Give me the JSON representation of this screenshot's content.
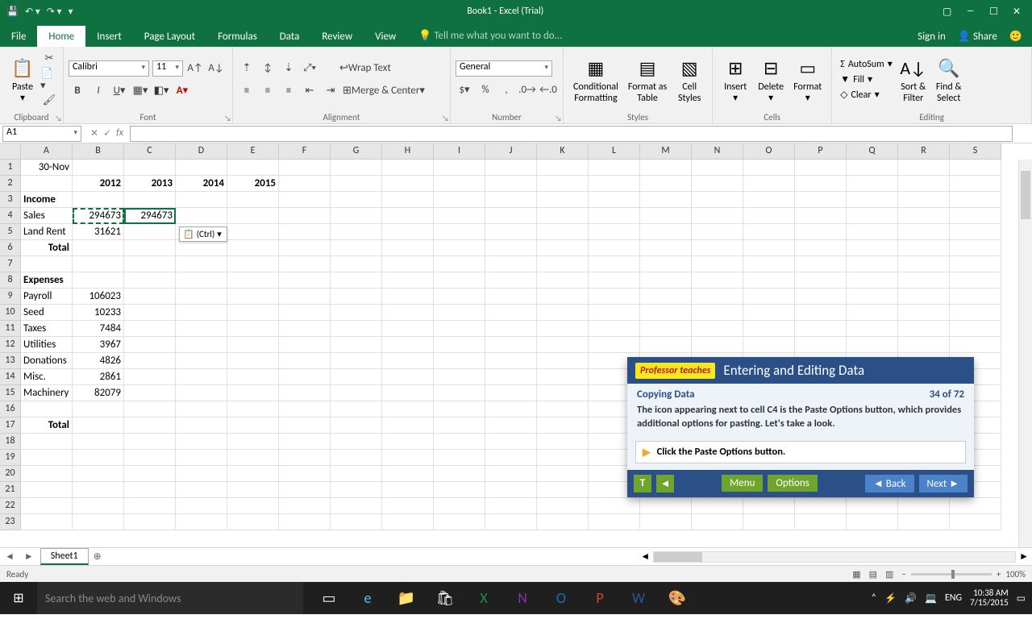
{
  "titlebar": {
    "title": "Book1 - Excel (Trial)"
  },
  "tabs": {
    "file": "File",
    "home": "Home",
    "insert": "Insert",
    "pagelayout": "Page Layout",
    "formulas": "Formulas",
    "data": "Data",
    "review": "Review",
    "view": "View",
    "tell": "Tell me what you want to do...",
    "signin": "Sign in",
    "share": "Share"
  },
  "ribbon": {
    "clipboard": {
      "label": "Clipboard",
      "paste": "Paste"
    },
    "font": {
      "label": "Font",
      "name": "Calibri",
      "size": "11"
    },
    "alignment": {
      "label": "Alignment",
      "wrap": "Wrap Text",
      "merge": "Merge & Center"
    },
    "number": {
      "label": "Number",
      "format": "General"
    },
    "styles": {
      "label": "Styles",
      "cond": "Conditional\nFormatting",
      "fat": "Format as\nTable",
      "cell": "Cell\nStyles"
    },
    "cells": {
      "label": "Cells",
      "insert": "Insert",
      "delete": "Delete",
      "format": "Format"
    },
    "editing": {
      "label": "Editing",
      "sum": "AutoSum",
      "fill": "Fill",
      "clear": "Clear",
      "sort": "Sort &\nFilter",
      "find": "Find &\nSelect"
    }
  },
  "namebox": "A1",
  "columns": [
    "A",
    "B",
    "C",
    "D",
    "E",
    "F",
    "G",
    "H",
    "I",
    "J",
    "K",
    "L",
    "M",
    "N",
    "O",
    "P",
    "Q",
    "R",
    "S"
  ],
  "rows": [
    "1",
    "2",
    "3",
    "4",
    "5",
    "6",
    "7",
    "8",
    "9",
    "10",
    "11",
    "12",
    "13",
    "14",
    "15",
    "16",
    "17",
    "18",
    "19",
    "20",
    "21",
    "22",
    "23"
  ],
  "cellsData": [
    {
      "r": 0,
      "c": 0,
      "v": "30-Nov",
      "cls": "r"
    },
    {
      "r": 1,
      "c": 1,
      "v": "2012",
      "cls": "r b"
    },
    {
      "r": 1,
      "c": 2,
      "v": "2013",
      "cls": "r b"
    },
    {
      "r": 1,
      "c": 3,
      "v": "2014",
      "cls": "r b"
    },
    {
      "r": 1,
      "c": 4,
      "v": "2015",
      "cls": "r b"
    },
    {
      "r": 2,
      "c": 0,
      "v": "Income",
      "cls": "b"
    },
    {
      "r": 3,
      "c": 0,
      "v": "Sales"
    },
    {
      "r": 3,
      "c": 1,
      "v": "294673",
      "cls": "r"
    },
    {
      "r": 3,
      "c": 2,
      "v": "294673",
      "cls": "r"
    },
    {
      "r": 4,
      "c": 0,
      "v": "Land Rent"
    },
    {
      "r": 4,
      "c": 1,
      "v": "31621",
      "cls": "r"
    },
    {
      "r": 5,
      "c": 0,
      "v": "Total",
      "cls": "r b"
    },
    {
      "r": 7,
      "c": 0,
      "v": "Expenses",
      "cls": "b"
    },
    {
      "r": 8,
      "c": 0,
      "v": "Payroll"
    },
    {
      "r": 8,
      "c": 1,
      "v": "106023",
      "cls": "r"
    },
    {
      "r": 9,
      "c": 0,
      "v": "Seed"
    },
    {
      "r": 9,
      "c": 1,
      "v": "10233",
      "cls": "r"
    },
    {
      "r": 10,
      "c": 0,
      "v": "Taxes"
    },
    {
      "r": 10,
      "c": 1,
      "v": "7484",
      "cls": "r"
    },
    {
      "r": 11,
      "c": 0,
      "v": "Utilities"
    },
    {
      "r": 11,
      "c": 1,
      "v": "3967",
      "cls": "r"
    },
    {
      "r": 12,
      "c": 0,
      "v": "Donations"
    },
    {
      "r": 12,
      "c": 1,
      "v": "4826",
      "cls": "r"
    },
    {
      "r": 13,
      "c": 0,
      "v": "Misc."
    },
    {
      "r": 13,
      "c": 1,
      "v": "2861",
      "cls": "r"
    },
    {
      "r": 14,
      "c": 0,
      "v": "Machinery"
    },
    {
      "r": 14,
      "c": 1,
      "v": "82079",
      "cls": "r"
    },
    {
      "r": 16,
      "c": 0,
      "v": "Total",
      "cls": "r b"
    }
  ],
  "pasteOptions": "(Ctrl)",
  "sheet": {
    "name": "Sheet1"
  },
  "status": {
    "ready": "Ready",
    "zoom": "100%"
  },
  "tutor": {
    "brand": "Professor teaches",
    "title": "Entering and Editing Data",
    "subtitle": "Copying Data",
    "progress": "34 of 72",
    "body": "The icon appearing next to cell C4 is the Paste Options button, which provides additional options for pasting. Let's take a look.",
    "action": "Click the Paste Options button.",
    "menu": "Menu",
    "options": "Options",
    "back": "Back",
    "next": "Next"
  },
  "taskbar": {
    "search": "Search the web and Windows",
    "time": "10:38 AM",
    "date": "7/15/2015",
    "lang": "ENG"
  }
}
